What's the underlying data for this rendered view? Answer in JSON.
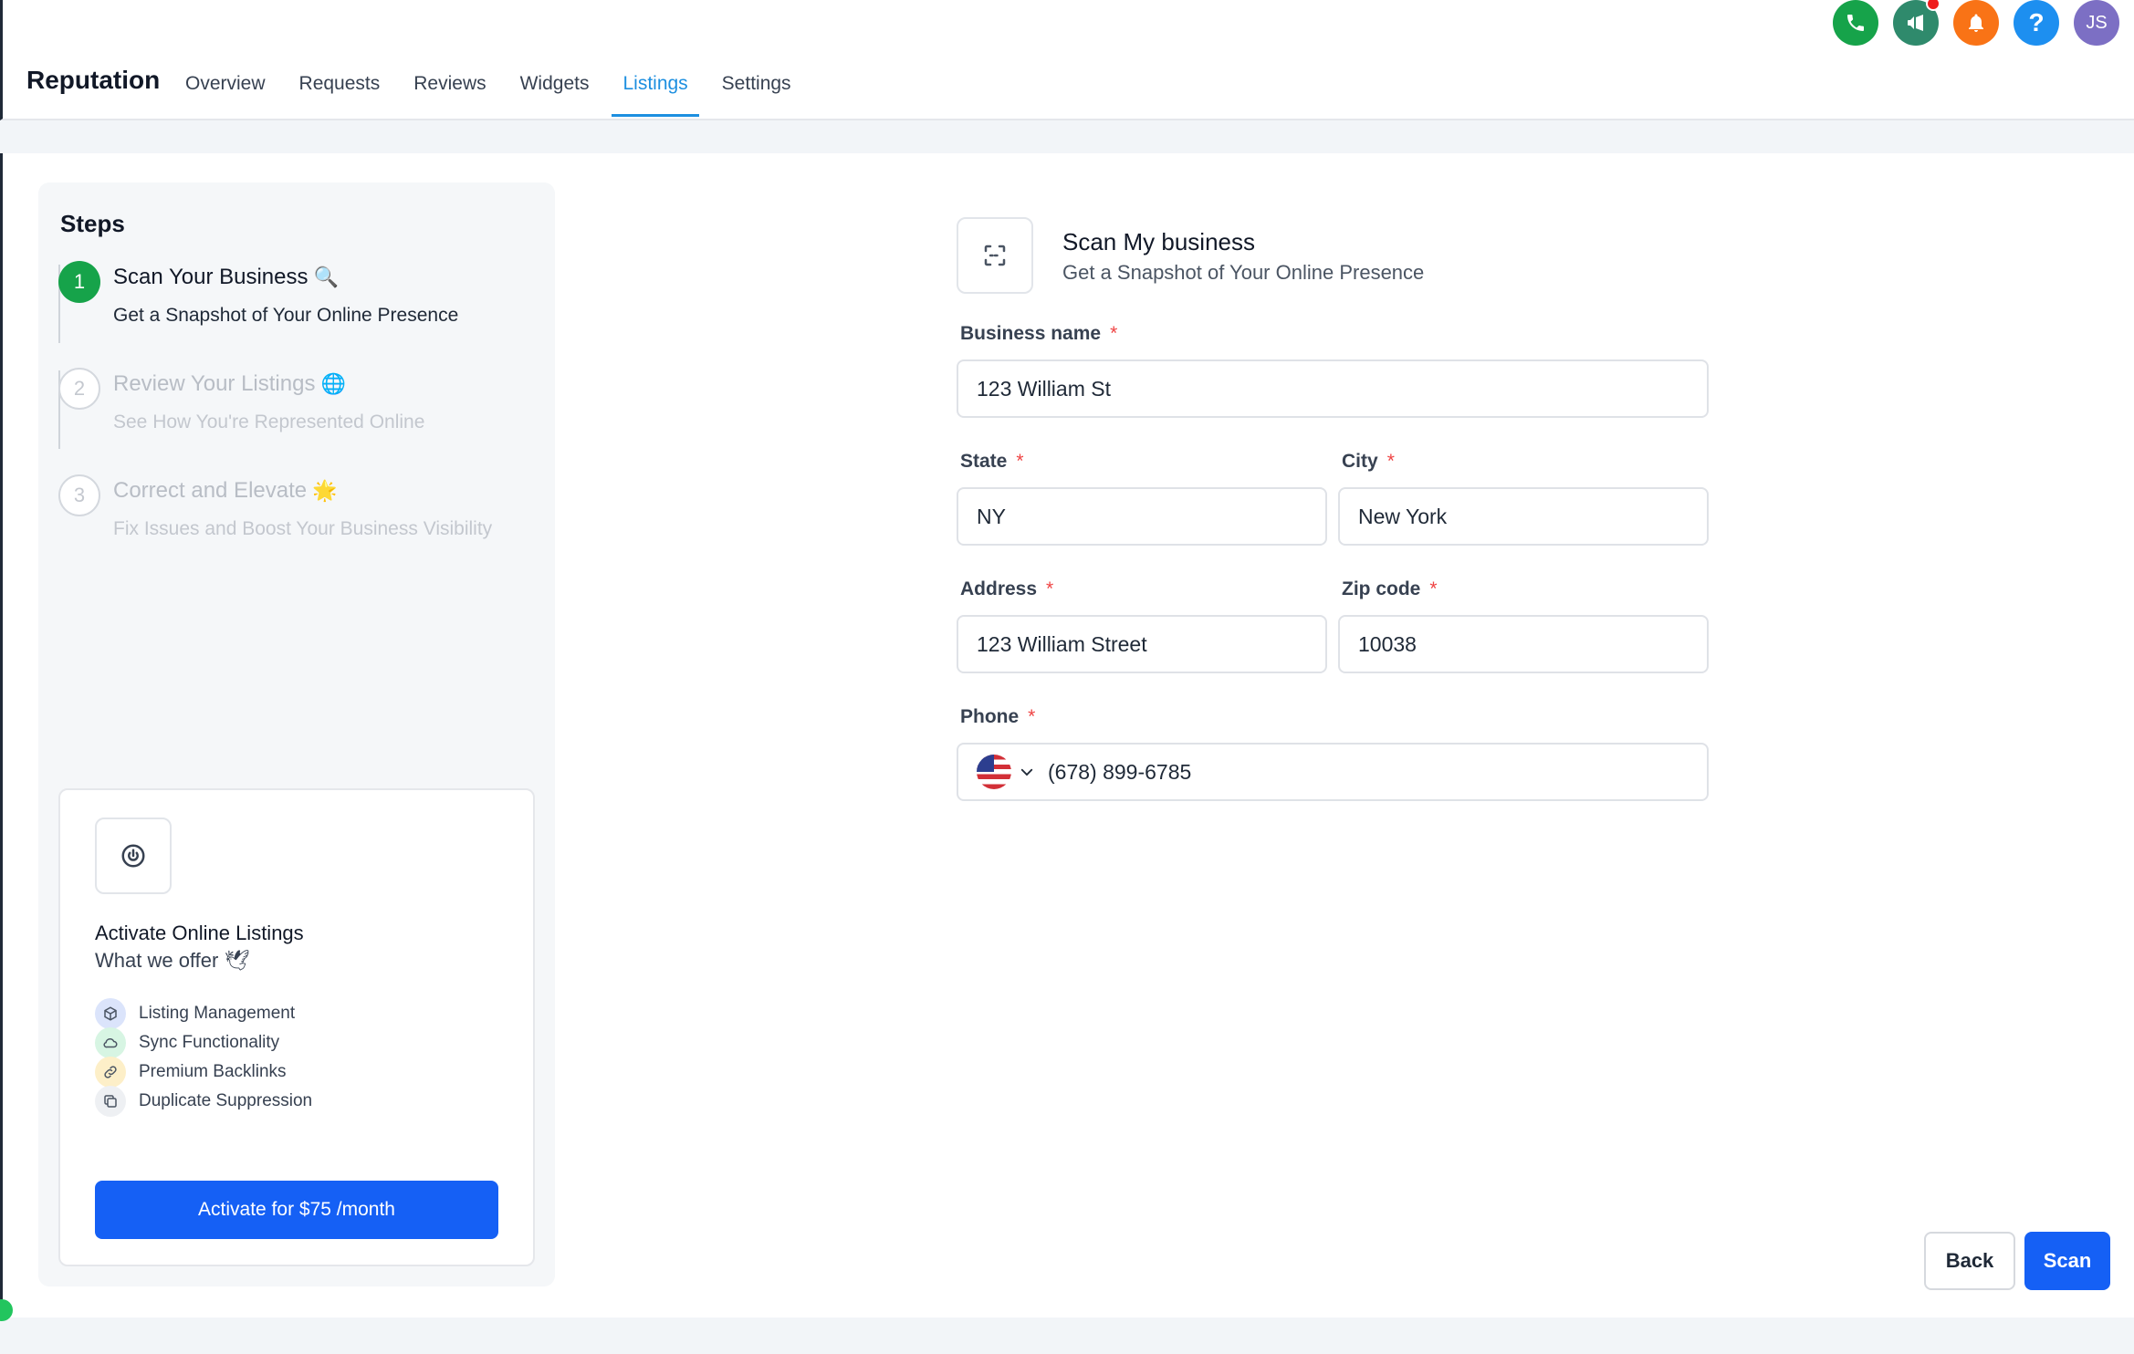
{
  "app": {
    "title": "Reputation"
  },
  "nav": {
    "items": [
      {
        "label": "Overview"
      },
      {
        "label": "Requests"
      },
      {
        "label": "Reviews"
      },
      {
        "label": "Widgets"
      },
      {
        "label": "Listings",
        "active": true
      },
      {
        "label": "Settings"
      }
    ]
  },
  "header_icons": [
    {
      "name": "phone-icon",
      "color": "#16a34a"
    },
    {
      "name": "megaphone-icon",
      "color": "#2f8a6c",
      "notification_dot": true
    },
    {
      "name": "bell-icon",
      "color": "#f97316"
    },
    {
      "name": "help-icon",
      "color": "#1d8ff0",
      "glyph": "?"
    },
    {
      "name": "avatar",
      "color": "#7c6fc4",
      "initials": "JS"
    }
  ],
  "steps": {
    "title": "Steps",
    "items": [
      {
        "number": "1",
        "title": "Scan Your Business",
        "emoji": "🔍",
        "subtitle": "Get a Snapshot of Your Online Presence",
        "state": "active"
      },
      {
        "number": "2",
        "title": "Review Your Listings",
        "emoji": "🌐",
        "subtitle": "See How You're Represented Online",
        "state": "inactive"
      },
      {
        "number": "3",
        "title": "Correct and Elevate",
        "emoji": "🌟",
        "subtitle": "Fix Issues and Boost Your Business Visibility",
        "state": "inactive"
      }
    ]
  },
  "offer": {
    "title": "Activate Online Listings",
    "subtitle": "What we offer",
    "subtitle_emoji": "🕊",
    "features": [
      {
        "label": "Listing Management",
        "icon": "cube-icon",
        "color": "#dbe4fb"
      },
      {
        "label": "Sync Functionality",
        "icon": "cloud-icon",
        "color": "#d7f5e3"
      },
      {
        "label": "Premium Backlinks",
        "icon": "link-icon",
        "color": "#fdefc8"
      },
      {
        "label": "Duplicate Suppression",
        "icon": "copy-icon",
        "color": "#eef0f3"
      }
    ],
    "button_label": "Activate for $75 /month"
  },
  "form": {
    "title": "Scan My business",
    "subtitle": "Get a Snapshot of Your Online Presence",
    "fields": {
      "business_name": {
        "label": "Business name",
        "value": "123 William St"
      },
      "state": {
        "label": "State",
        "value": "NY"
      },
      "city": {
        "label": "City",
        "value": "New York"
      },
      "address": {
        "label": "Address",
        "value": "123 William Street"
      },
      "zip": {
        "label": "Zip code",
        "value": "10038"
      },
      "phone": {
        "label": "Phone",
        "value": "(678) 899-6785",
        "country": "US"
      }
    },
    "required_marker": "*"
  },
  "actions": {
    "back_label": "Back",
    "scan_label": "Scan"
  },
  "colors": {
    "primary": "#1560f5",
    "active_tab": "#1d8fe0",
    "step_done": "#16a34a",
    "required": "#ef4444"
  }
}
